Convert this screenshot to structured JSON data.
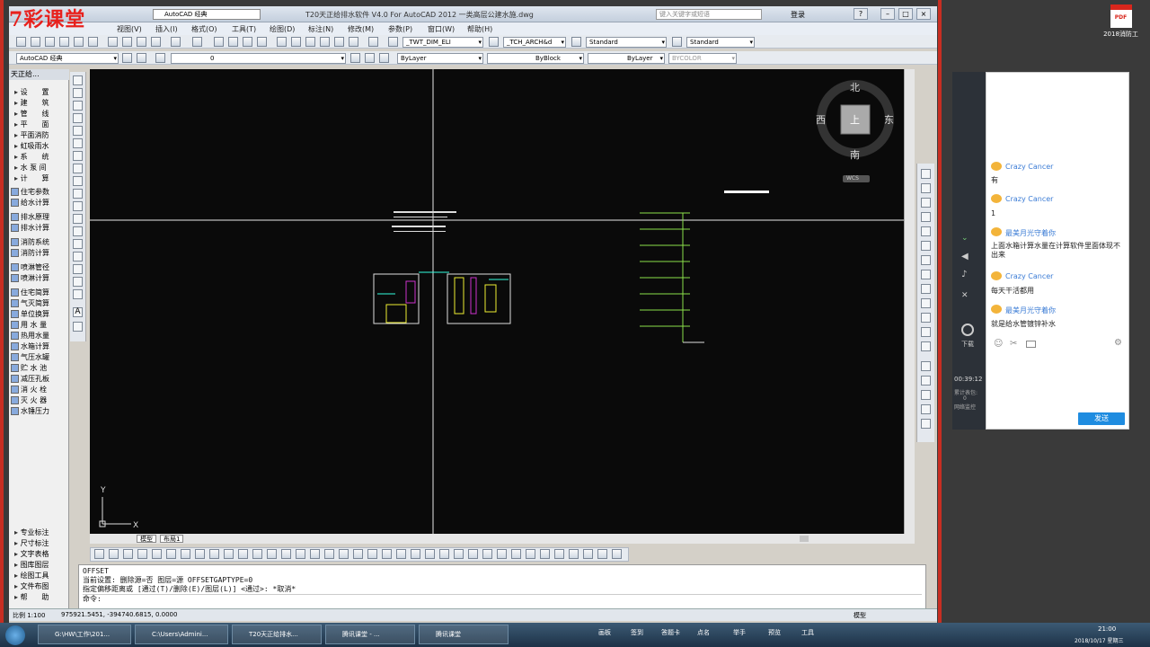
{
  "logo_text": "7彩课堂",
  "title": "T20天正给排水软件 V4.0 For AutoCAD 2012    一类高层公建水施.dwg",
  "workspace_title": "AutoCAD 经典",
  "search_placeholder": "键入关键字或短语",
  "login": "登录",
  "menus": [
    "视图(V)",
    "插入(I)",
    "格式(O)",
    "工具(T)",
    "绘图(D)",
    "标注(N)",
    "修改(M)",
    "参数(P)",
    "窗口(W)",
    "帮助(H)"
  ],
  "toolbar": {
    "dimstyle": "_TWT_DIM_ELI",
    "textstyle": "_TCH_ARCH&d",
    "tablestyle": "Standard",
    "mleaderstyle": "Standard",
    "workspace": "AutoCAD 经典",
    "layer": "0",
    "color": "ByLayer",
    "linetype": "ByBlock",
    "lineweight": "ByLayer",
    "plotstyle": "BYCOLOR"
  },
  "panel": {
    "header": "天正给...",
    "groups": [
      "设　　置",
      "建　　筑",
      "管　　线",
      "平　　面",
      "平面消防",
      "虹吸雨水",
      "系　　统",
      "水 泵 间",
      "计　　算"
    ],
    "commands": [
      "住宅参数",
      "给水计算",
      "排水原理",
      "排水计算",
      "消防系统",
      "消防计算",
      "喷淋管径",
      "喷淋计算",
      "住宅简算",
      "气灭简算",
      "单位换算",
      "用 水 量",
      "热用水量",
      "水箱计算",
      "气压水罐",
      "贮 水 池",
      "减压孔板",
      "消 火 栓",
      "灭 火 器",
      "水锤压力"
    ],
    "bottom_groups": [
      "专业标注",
      "尺寸标注",
      "文字表格",
      "图库图层",
      "绘图工具",
      "文件布图",
      "帮　　助"
    ]
  },
  "viewcube": {
    "north": "北",
    "south": "南",
    "east": "东",
    "west": "西",
    "top": "上",
    "wcs": "WCS"
  },
  "layout_tabs": [
    "模型",
    "布局1"
  ],
  "command_lines": [
    "OFFSET",
    "当前设置: 删除源=否  图层=源  OFFSETGAPTYPE=0",
    "指定偏移距离或 [通过(T)/删除(E)/图层(L)] <通过>:  *取消*",
    "命令:"
  ],
  "status": {
    "scale": "比例 1:100",
    "coords": "975921.5451,  -394740.6815,  0.0000",
    "model": "模型"
  },
  "chat": {
    "messages": [
      {
        "user": "Crazy Cancer",
        "text": "有"
      },
      {
        "user": "Crazy Cancer",
        "text": "1"
      },
      {
        "user": "最美月光守着你",
        "text": "上面水箱计算水量在计算软件里面体现不出来"
      },
      {
        "user": "Crazy Cancer",
        "text": "每天干活都用"
      },
      {
        "user": "最美月光守着你",
        "text": "就是给水管镀锌补水"
      }
    ],
    "send": "发送",
    "timer": "00:39:12",
    "counter_label": "累计表包:",
    "counter_value": "0",
    "network": "网络监控",
    "download": "下载"
  },
  "desktop_icon": {
    "badge": "PDF",
    "label": "2018消防工"
  },
  "taskbar": {
    "tasks": [
      "G:\\HW\\工作\\201...",
      "C:\\Users\\Admini...",
      "T20天正给排水...",
      "腾讯课堂 - ...",
      "腾讯课堂"
    ],
    "tray_items": [
      "画板",
      "签到",
      "答题卡",
      "举手",
      "点名",
      "预览",
      "工具"
    ],
    "time": "21:00",
    "date": "2018/10/17 星期三"
  },
  "colors": {
    "logo": "#e8201c",
    "accent": "#1f8ce0",
    "canvas": "#0a0a0a"
  }
}
